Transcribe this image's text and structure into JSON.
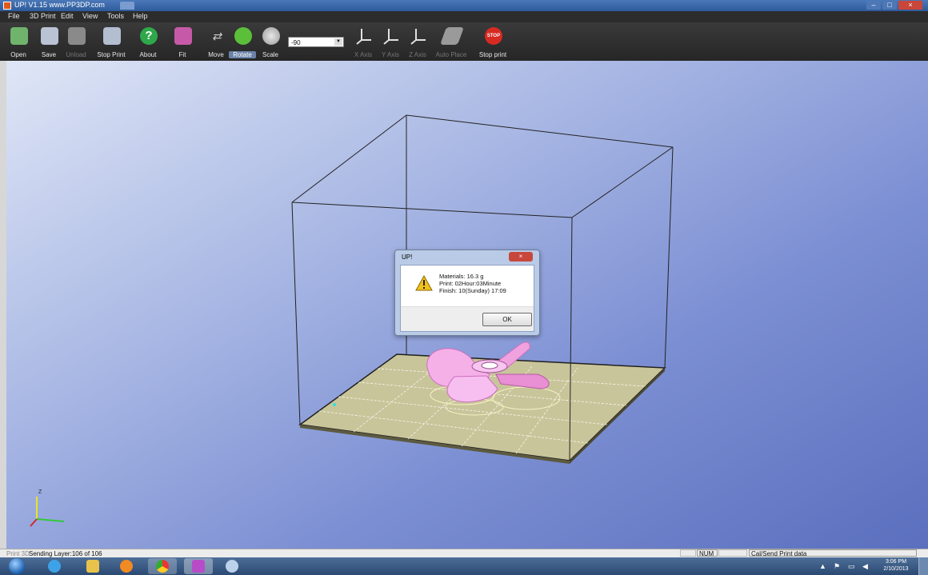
{
  "window": {
    "title": "UP!  V1.15  www.PP3DP.com",
    "controls": {
      "minimize": "–",
      "maximize": "□",
      "close": "×"
    }
  },
  "menu": [
    "File",
    "3D Print",
    "Edit",
    "View",
    "Tools",
    "Help"
  ],
  "toolbar": {
    "buttons": [
      {
        "label": "Open",
        "icon": "open-icon",
        "color": "#6fb36c"
      },
      {
        "label": "Save",
        "icon": "save-icon",
        "color": "#b9c3d4"
      },
      {
        "label": "Unload",
        "icon": "unload-icon",
        "color": "#8a8a8a",
        "disabled": true
      },
      {
        "label": "Stop Print",
        "icon": "printer-icon",
        "color": "#b3bed0"
      },
      {
        "label": "About",
        "icon": "help-icon",
        "color": "#2ea84a"
      },
      {
        "label": "Fit",
        "icon": "fit-icon",
        "color": "#c65aa8"
      },
      {
        "label": "Move",
        "icon": "move-icon",
        "color": "#bdbdbd"
      },
      {
        "label": "Rotate",
        "icon": "rotate-icon",
        "color": "#5cbf3a",
        "selected": true
      },
      {
        "label": "Scale",
        "icon": "scale-icon",
        "color": "#b9b9b9"
      },
      {
        "label": "X Axis",
        "icon": "x-axis-icon",
        "color": "#d0d0d0",
        "disabled": true
      },
      {
        "label": "Y Axis",
        "icon": "y-axis-icon",
        "color": "#d0d0d0",
        "disabled": true
      },
      {
        "label": "Z Axis",
        "icon": "z-axis-icon",
        "color": "#d0d0d0",
        "disabled": true
      },
      {
        "label": "Auto Place",
        "icon": "auto-place-icon",
        "color": "#9a9a9a",
        "disabled": true
      },
      {
        "label": "Stop print",
        "icon": "stop-icon",
        "color": "#d62a22"
      }
    ],
    "angle_value": "-90",
    "stop_sign_text": "STOP"
  },
  "viewport": {
    "axis_labels": {
      "z": "Z",
      "x": "X",
      "y": "Y"
    },
    "colors": {
      "part": "#f4a8e6",
      "platform": "#c9c59a",
      "background_top": "#dfe6f6",
      "background_bottom": "#5a6fbe"
    }
  },
  "dialog": {
    "title": "UP!",
    "lines": [
      "Materials: 16.3 g",
      "Print: 02Hour:03Minute",
      "Finish: 10(Sunday) 17:09"
    ],
    "ok_label": "OK",
    "close_label": "×",
    "icon": "warning-icon"
  },
  "status": {
    "left_label": "Print 3D",
    "message": "Sending Layer:106 of 106",
    "num": "NUM",
    "right_message": "Cal/Send Print data"
  },
  "taskbar": {
    "apps": [
      "ie-icon",
      "explorer-icon",
      "media-player-icon",
      "chrome-icon",
      "up-icon",
      "paint-icon"
    ],
    "time": "3:06 PM",
    "date": "2/10/2013"
  }
}
